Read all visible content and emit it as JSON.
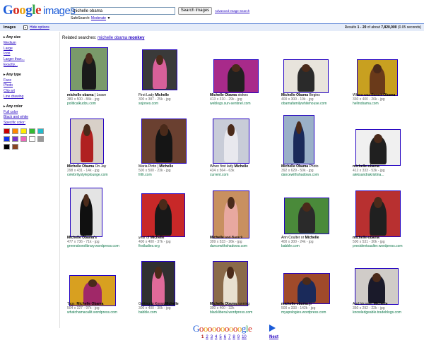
{
  "header": {
    "logo_text": "Google",
    "logo_sub": "images",
    "search_value": "michelle obama",
    "search_button": "Search Images",
    "advanced_link": "Advanced Image Search",
    "safesearch_label": "SafeSearch:",
    "safesearch_value": "Moderate"
  },
  "bar": {
    "section": "Images",
    "hide_options": "Hide options",
    "results_prefix": "Results ",
    "results_range": "1 - 20",
    "results_mid": " of about ",
    "results_count": "7,820,000",
    "results_time": " (0.05 seconds)"
  },
  "sidebar": {
    "size_head": "Any size",
    "size_items": [
      "Medium",
      "Large",
      "Icon",
      "Larger than...",
      "Exactly..."
    ],
    "type_head": "Any type",
    "type_items": [
      "Face",
      "Photo",
      "Clip art",
      "Line drawing"
    ],
    "color_head": "Any color",
    "color_items": [
      "Full color",
      "Black and white",
      "Specific color:"
    ],
    "swatch_colors": [
      "#cc0000",
      "#ff8800",
      "#ffee00",
      "#33bb33",
      "#22bbcc",
      "#1133ee",
      "#7733cc",
      "#ee66bb",
      "#ffffff",
      "#999999",
      "#000000",
      "#884422"
    ]
  },
  "related": {
    "label": "Related searches:",
    "term_plain": "michelle obama",
    "term_bold": "monkey"
  },
  "results": [
    {
      "t_pre": "",
      "t_b1": "michelle obama",
      "t_mid": " | Leave",
      "t_b2": "",
      "meta": "380 x 500 - 84k - jpg",
      "site": "politicalkudzu.com",
      "bg": "#7a9a6a",
      "fig": "#1a1a1a"
    },
    {
      "t_pre": "First Lady ",
      "t_b1": "Michelle",
      "t_mid": "",
      "t_b2": "",
      "meta": "300 x 387 - 25k - jpg",
      "site": "sojones.com",
      "bg": "#3a3a3a",
      "fig": "#d8609a"
    },
    {
      "t_pre": "",
      "t_b1": "Michelle Obama",
      "t_mid": " stokes",
      "t_b2": "",
      "meta": "413 x 310 - 29k - jpg",
      "site": "weblogs.sun-sentinel.com",
      "bg": "#a82a8a",
      "fig": "#202020"
    },
    {
      "t_pre": "",
      "t_b1": "Michelle Obama",
      "t_mid": " Begins",
      "t_b2": "",
      "meta": "400 x 300 - 19k - jpg",
      "site": "obamafamilywhitehouse.com",
      "bg": "#e8e4dc",
      "fig": "#2a2a2a"
    },
    {
      "t_pre": "Where was Barack ",
      "t_b1": "Obama",
      "t_mid": "",
      "t_b2": "",
      "meta": "330 x 400 - 26k - jpg",
      "site": "hellnobama.com",
      "bg": "#c8a020",
      "fig": "#6a3a1a"
    },
    {
      "t_pre": "",
      "t_b1": "Michelle Obama",
      "t_mid": " On Jay",
      "t_b2": "",
      "meta": "298 x 431 - 14k - jpg",
      "site": "celebritystyleplounge.com",
      "bg": "#d8d0c8",
      "fig": "#b02020"
    },
    {
      "t_pre": "Maria Pinto | ",
      "t_b1": "Michelle",
      "t_mid": "",
      "t_b2": "",
      "meta": "500 x 500 - 23k - jpg",
      "site": "frillr.com",
      "bg": "#6a4030",
      "fig": "#151515"
    },
    {
      "t_pre": "When first lady ",
      "t_b1": "Michelle",
      "t_mid": "",
      "t_b2": "",
      "meta": "434 x 564 - 63k",
      "site": "current.com",
      "bg": "#c8ccd8",
      "fig": "#e8e8ee"
    },
    {
      "t_pre": "",
      "t_b1": "Michelle Obama",
      "t_mid": " Photo",
      "t_b2": "",
      "meta": "392 x 629 - 50k - jpg",
      "site": "dancewithshadows.com",
      "bg": "#9ab0c8",
      "fig": "#1a2a5a"
    },
    {
      "t_pre": "",
      "t_b1": "michelle-obama",
      "t_mid": "",
      "t_b2": "",
      "meta": "412 x 333 - 53k - jpg",
      "site": "aleksandrakristina...",
      "bg": "#f0f0f0",
      "fig": "#202020"
    },
    {
      "t_pre": "",
      "t_b1": "Michelle Obama's",
      "t_mid": "",
      "t_b2": "",
      "meta": "477 x 736 - 71k - jpg",
      "site": "greensborolibrary.wordpress.com",
      "bg": "#e4e4e4",
      "fig": "#101010"
    },
    {
      "t_pre": "year of ",
      "t_b1": "Michelle",
      "t_mid": "",
      "t_b2": "",
      "meta": "400 x 400 - 37k - jpg",
      "site": "firstladies.org",
      "bg": "#c82828",
      "fig": "#181818"
    },
    {
      "t_pre": "",
      "t_b1": "Michelle",
      "t_mid": " and Barack",
      "t_b2": "",
      "meta": "399 x 533 - 26k - jpg",
      "site": "dancewithshadows.com",
      "bg": "#c89060",
      "fig": "#e8a8a0"
    },
    {
      "t_pre": "Ann Coulter or ",
      "t_b1": "Michelle",
      "t_mid": "",
      "t_b2": "",
      "meta": "400 x 300 - 24k - jpg",
      "site": "babble.com",
      "bg": "#4a8a3a",
      "fig": "#2a2a2a"
    },
    {
      "t_pre": "",
      "t_b1": "michelle-obama",
      "t_mid": "",
      "t_b2": "",
      "meta": "500 x 531 - 30k - jpg",
      "site": "presidentsaulter.wordpress.com",
      "bg": "#b83030",
      "fig": "#202020"
    },
    {
      "t_pre": "Tags: ",
      "t_b1": "Michelle Obama",
      "t_mid": "",
      "t_b2": "",
      "meta": "504 x 327 - 97k - jpg",
      "site": "whatchamacallit.wordpress.com",
      "bg": "#d8a020",
      "fig": "#a02868"
    },
    {
      "t_pre": "Getting to Know ",
      "t_b1": "Michelle",
      "t_mid": "",
      "t_b2": "",
      "meta": "300 x 400 - 30k - jpg",
      "site": "babble.com",
      "bg": "#303030",
      "fig": "#e06a9a"
    },
    {
      "t_pre": "",
      "t_b1": "Michelle Obama",
      "t_mid": " running",
      "t_b2": "",
      "meta": "300 x 400 - 32k",
      "site": "blackliberal.wordpress.com",
      "bg": "#8a6a4a",
      "fig": "#e8e0d0"
    },
    {
      "t_pre": "",
      "t_b1": "michelle-obama",
      "t_mid": ".jp",
      "t_b2": "",
      "meta": "500 x 333 - 142k - jpg",
      "site": "myapologies.wordpress.com",
      "bg": "#a04a2a",
      "fig": "#1a2a5a"
    },
    {
      "t_pre": "And his wife, ",
      "t_b1": "Michelle",
      "t_mid": "",
      "t_b2": "",
      "meta": "350 x 292 - 22k - jpg",
      "site": "knowledgeable.tradeblogs.com",
      "bg": "#d0ccc8",
      "fig": "#1a1a2a"
    }
  ],
  "pager": {
    "logo": "Goooooooooogle",
    "pages": [
      "1",
      "2",
      "3",
      "4",
      "5",
      "6",
      "7",
      "8",
      "9",
      "10"
    ],
    "next": "Next"
  }
}
